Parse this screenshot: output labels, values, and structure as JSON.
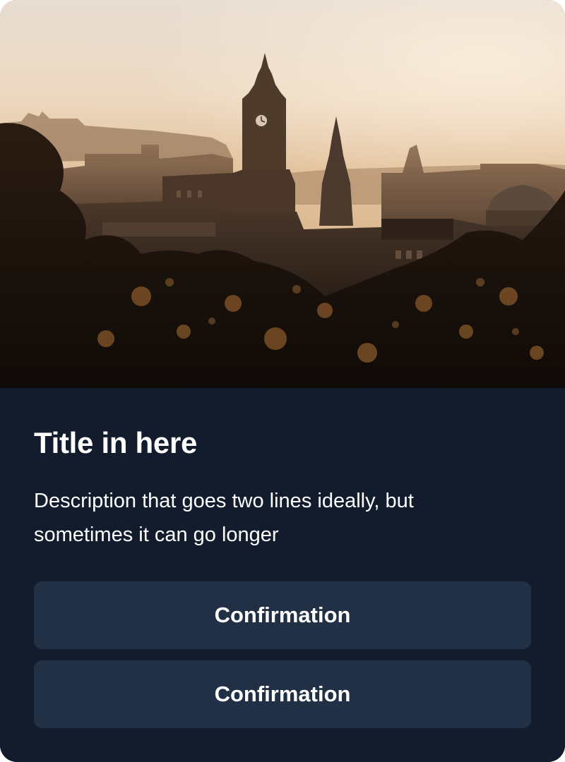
{
  "card": {
    "image": {
      "alt_subject": "city-skyline-photo"
    },
    "title": "Title in here",
    "description": "Description that goes two lines ideally, but sometimes it can go longer",
    "buttons": [
      {
        "label": "Confirmation"
      },
      {
        "label": "Confirmation"
      }
    ]
  },
  "colors": {
    "card_background": "#131c2c",
    "button_background": "#223046",
    "text": "#ffffff"
  }
}
